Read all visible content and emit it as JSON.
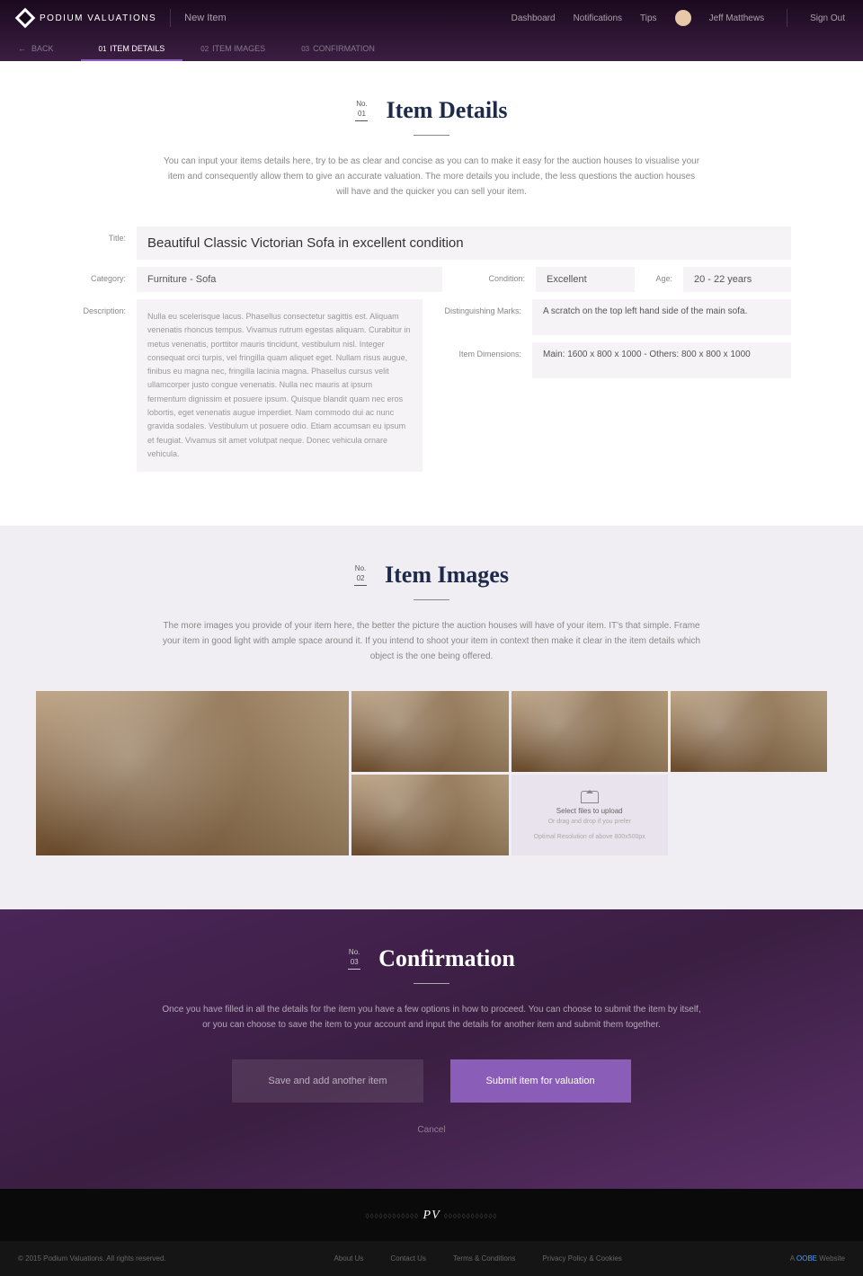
{
  "header": {
    "brand": "PODIUM VALUATIONS",
    "page": "New Item",
    "nav": [
      "Dashboard",
      "Notifications",
      "Tips"
    ],
    "user": "Jeff Matthews",
    "signout": "Sign Out"
  },
  "subnav": {
    "back": "BACK",
    "tabs": [
      {
        "no": "01",
        "label": "ITEM DETAILS"
      },
      {
        "no": "02",
        "label": "ITEM IMAGES"
      },
      {
        "no": "03",
        "label": "CONFIRMATION"
      }
    ]
  },
  "details": {
    "no_label": "No.",
    "no": "01",
    "heading": "Item Details",
    "intro": "You can input your items details here, try to be as clear and concise as you can to make it easy for the auction houses to visualise your item and consequently allow them to give an accurate valuation. The more details you include, the less questions the auction houses will have and the quicker you can sell your item.",
    "fields": {
      "title_label": "Title:",
      "title": "Beautiful Classic Victorian Sofa in excellent condition",
      "category_label": "Category:",
      "category": "Furniture - Sofa",
      "condition_label": "Condition:",
      "condition": "Excellent",
      "age_label": "Age:",
      "age": "20 - 22 years",
      "description_label": "Description:",
      "description": "Nulla eu scelerisque lacus. Phasellus consectetur sagittis est. Aliquam venenatis rhoncus tempus. Vivamus rutrum egestas aliquam. Curabitur in metus venenatis, porttitor mauris tincidunt, vestibulum nisl. Integer consequat orci turpis, vel fringilla quam aliquet eget. Nullam risus augue, finibus eu magna nec, fringilla lacinia magna. Phasellus cursus velit ullamcorper justo congue venenatis. Nulla nec mauris at ipsum fermentum dignissim et posuere ipsum. Quisque blandit quam nec eros lobortis, eget venenatis augue imperdiet. Nam commodo dui ac nunc gravida sodales. Vestibulum ut posuere odio. Etiam accumsan eu ipsum et feugiat. Vivamus sit amet volutpat neque. Donec vehicula ornare vehicula.",
      "marks_label": "Distinguishing Marks:",
      "marks": "A scratch on the top left hand side of the main sofa.",
      "dimensions_label": "Item Dimensions:",
      "dimensions": "Main: 1600 x 800 x 1000 - Others: 800 x 800 x 1000"
    }
  },
  "images": {
    "no_label": "No.",
    "no": "02",
    "heading": "Item Images",
    "intro": "The more images you provide of your item here, the better the picture the auction houses will have of your item. IT's that simple. Frame your item in good light with ample space around it. If you intend to shoot your item in context then make it clear in the item details which object is the one being offered.",
    "upload": {
      "title": "Select files to upload",
      "sub": "Or drag and drop if you prefer",
      "hint": "Optimal Resolution of above 800x500px"
    }
  },
  "confirm": {
    "no_label": "No.",
    "no": "03",
    "heading": "Confirmation",
    "intro": "Once you have filled in all the details for the item you have a few options in how to proceed. You can choose to submit the item by itself, or you can choose to save the item to your account and input the details for another item  and submit them together.",
    "save": "Save and add another item",
    "submit": "Submit item for valuation",
    "cancel": "Cancel"
  },
  "footer": {
    "copyright": "© 2015 Podium Valuations. All rights reserved.",
    "links": [
      "About Us",
      "Contact Us",
      "Terms & Conditions",
      "Privacy Policy & Cookies"
    ],
    "credit_prefix": "A ",
    "credit_brand": "OOBE",
    "credit_suffix": " Website"
  }
}
